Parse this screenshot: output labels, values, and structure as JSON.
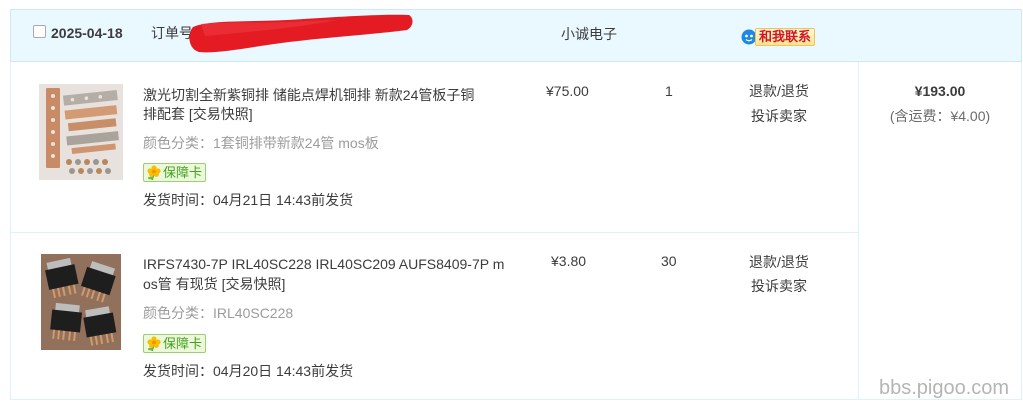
{
  "order": {
    "date": "2025-04-18",
    "order_no_label": "订单号",
    "shop_name": "小诚电子",
    "contact_label": "和我联系",
    "total_amount": "¥193.00",
    "shipping_note": "(含运费：¥4.00)"
  },
  "items": [
    {
      "title_lines": [
        "激光切割全新紫铜排 储能点焊机铜排 新款24管板子铜",
        "排配套"
      ],
      "snapshot_label": "[交易快照]",
      "sku_label": "颜色分类：",
      "sku_value": "1套铜排带新款24管 mos板",
      "badge_label": "保障卡",
      "ship_time": "发货时间：04月21日 14:43前发货",
      "price": "¥75.00",
      "quantity": "1",
      "actions": [
        "退款/退货",
        "投诉卖家"
      ]
    },
    {
      "title_lines": [
        "IRFS7430-7P IRL40SC228 IRL40SC209 AUFS8409-7P m",
        "os管 有现货"
      ],
      "snapshot_label": "[交易快照]",
      "sku_label": "颜色分类：",
      "sku_value": "IRL40SC228",
      "badge_label": "保障卡",
      "ship_time": "发货时间：04月20日 14:43前发货",
      "price": "¥3.80",
      "quantity": "30",
      "actions": [
        "退款/退货",
        "投诉卖家"
      ]
    }
  ],
  "watermark": "bbs.pigoo.com",
  "icons": {
    "order_select": "checkbox-icon",
    "contact": "wangwang-icon",
    "guarantee": "flower-icon"
  },
  "colors": {
    "text": "#3c3c3c",
    "muted": "#9c9c9c",
    "header_bg": "#eaf8ff",
    "header_border": "#cde9f8",
    "body_border": "#daf3ff",
    "redaction": "#e41b23",
    "badge_green": "#44a11d",
    "contact_red": "#d0182b",
    "wangwang_blue": "#1e88e5"
  }
}
